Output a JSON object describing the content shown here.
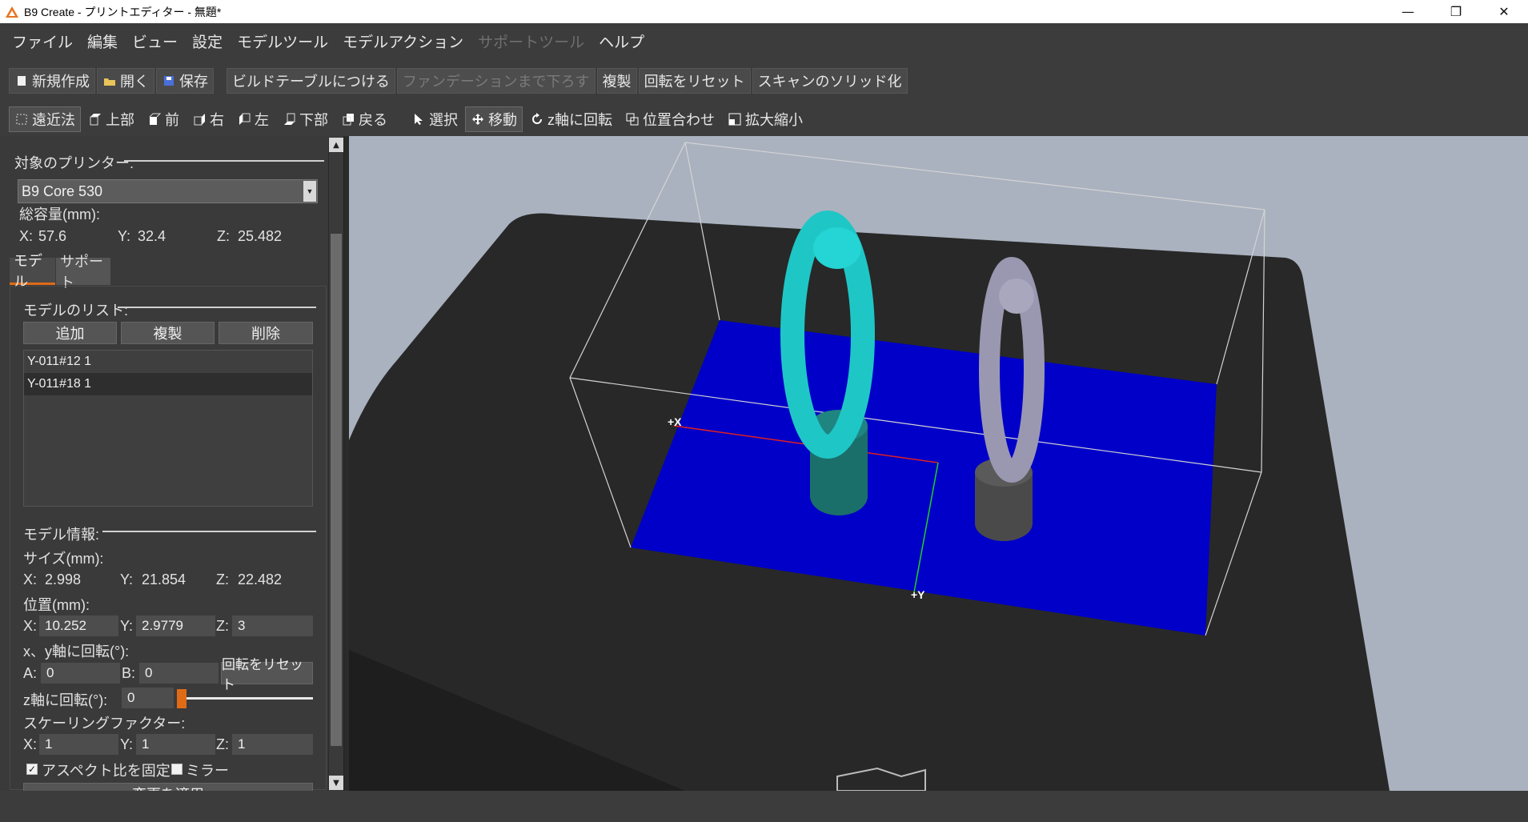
{
  "window": {
    "title": "B9 Create - プリントエディター - 無題*",
    "minimize": "—",
    "restore": "❐",
    "close": "✕"
  },
  "menu": {
    "items": [
      "ファイル",
      "編集",
      "ビュー",
      "設定",
      "モデルツール",
      "モデルアクション",
      "サポートツール",
      "ヘルプ"
    ]
  },
  "toolbar1": {
    "new": "新規作成",
    "open": "開く",
    "save": "保存",
    "attach_build_table": "ビルドテーブルにつける",
    "lower_to_foundation": "ファンデーションまで下ろす",
    "duplicate": "複製",
    "reset_rotation": "回転をリセット",
    "solidify_scan": "スキャンのソリッド化"
  },
  "toolbar2": {
    "perspective": "遠近法",
    "top": "上部",
    "front": "前",
    "right": "右",
    "left": "左",
    "bottom": "下部",
    "back": "戻る",
    "select": "選択",
    "move": "移動",
    "rotate_z": "z軸に回転",
    "align": "位置合わせ",
    "scale": "拡大縮小"
  },
  "panel": {
    "target_printer_label": "対象のプリンター:",
    "printer": "B9 Core 530",
    "volume_label": "総容量(mm):",
    "volume": {
      "x_label": "X:",
      "x": "57.6",
      "y_label": "Y:",
      "y": "32.4",
      "z_label": "Z:",
      "z": "25.482"
    },
    "tabs": {
      "model": "モデル",
      "support": "サポート"
    },
    "model_list_label": "モデルのリスト:",
    "add": "追加",
    "duplicate": "複製",
    "delete": "削除",
    "models": [
      "Y-011#12 1",
      "Y-011#18 1"
    ],
    "model_info_label": "モデル情報:",
    "size_label": "サイズ(mm):",
    "size": {
      "x_label": "X:",
      "x": "2.998",
      "y_label": "Y:",
      "y": "21.854",
      "z_label": "Z:",
      "z": "22.482"
    },
    "position_label": "位置(mm):",
    "position": {
      "x_label": "X:",
      "x": "10.252",
      "y_label": "Y:",
      "y": "2.9779",
      "z_label": "Z:",
      "z": "3"
    },
    "xy_rotation_label": "x、y軸に回転(°):",
    "rot_a_label": "A:",
    "rot_a": "0",
    "rot_b_label": "B:",
    "rot_b": "0",
    "reset_rotation": "回転をリセット",
    "z_rotation_label": "z軸に回転(°):",
    "z_rotation": "0",
    "z_rotation_fraction": 0,
    "scaling_label": "スケーリングファクター:",
    "scale": {
      "x_label": "X:",
      "x": "1",
      "y_label": "Y:",
      "y": "1",
      "z_label": "Z:",
      "z": "1"
    },
    "lock_aspect": "アスペクト比を固定",
    "lock_aspect_checked": true,
    "mirror": "ミラー",
    "mirror_checked": false,
    "apply_changes": "変更を適用"
  },
  "viewport": {
    "axis_x_label": "+X",
    "axis_y_label": "+Y",
    "colors": {
      "background": "#aab2bf",
      "platform": "#0000c8",
      "model1": "#1fc6c6",
      "model2": "#9a98b0",
      "base": "#2a2a2a"
    }
  },
  "colors": {
    "accent": "#e06b16"
  }
}
